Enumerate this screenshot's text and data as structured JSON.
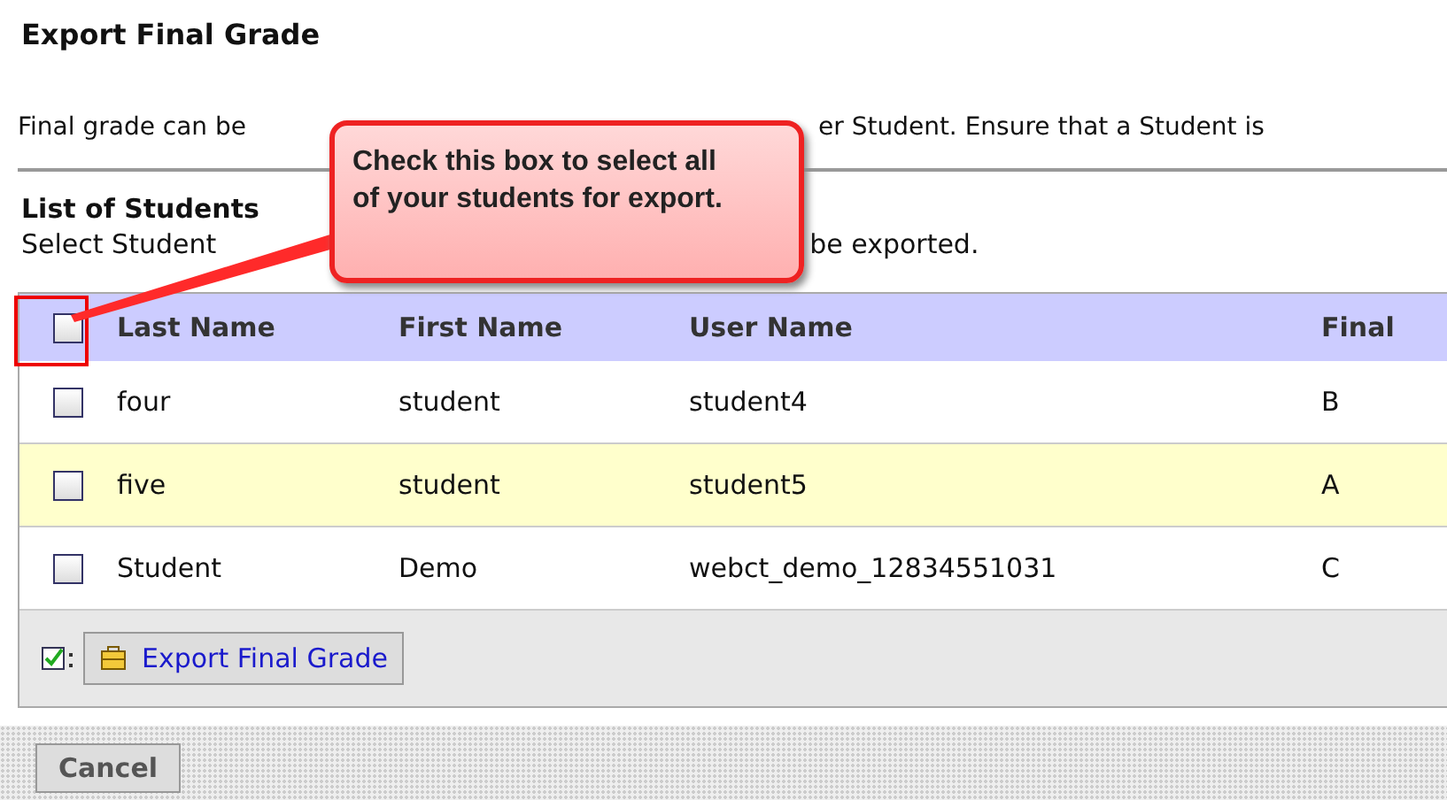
{
  "title": "Export Final Grade",
  "description": {
    "before": "Final grade can be",
    "after": "er Student. Ensure that a Student is"
  },
  "list": {
    "heading": "List of Students",
    "hint_before": "Select Student",
    "hint_after": "be exported."
  },
  "table": {
    "select_all": {
      "checked": false
    },
    "columns": [
      "Last Name",
      "First Name",
      "User Name",
      "Final"
    ],
    "rows": [
      {
        "checked": false,
        "highlighted": false,
        "cells": [
          "four",
          "student",
          "student4",
          "B"
        ]
      },
      {
        "checked": false,
        "highlighted": true,
        "cells": [
          "five",
          "student",
          "student5",
          "A"
        ]
      },
      {
        "checked": false,
        "highlighted": false,
        "cells": [
          "Student",
          "Demo",
          "webct_demo_12834551031",
          "C"
        ]
      }
    ],
    "action": "Export Final Grade"
  },
  "cancel": "Cancel",
  "callout": {
    "text": "Check this box to select all of your students for export."
  }
}
